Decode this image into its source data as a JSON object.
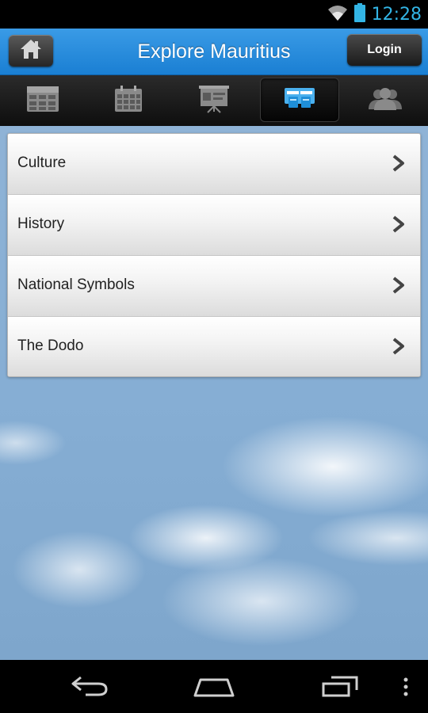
{
  "status_bar": {
    "time": "12:28"
  },
  "header": {
    "title": "Explore Mauritius",
    "login_label": "Login"
  },
  "tabs": [
    {
      "icon": "table-icon",
      "active": false
    },
    {
      "icon": "calendar-icon",
      "active": false
    },
    {
      "icon": "presentation-icon",
      "active": false
    },
    {
      "icon": "info-cards-icon",
      "active": true
    },
    {
      "icon": "users-icon",
      "active": false
    }
  ],
  "menu": {
    "items": [
      {
        "label": "Culture"
      },
      {
        "label": "History"
      },
      {
        "label": "National Symbols"
      },
      {
        "label": "The Dodo"
      }
    ]
  },
  "colors": {
    "header": "#1a7fd3",
    "status_time": "#33b5e5"
  }
}
